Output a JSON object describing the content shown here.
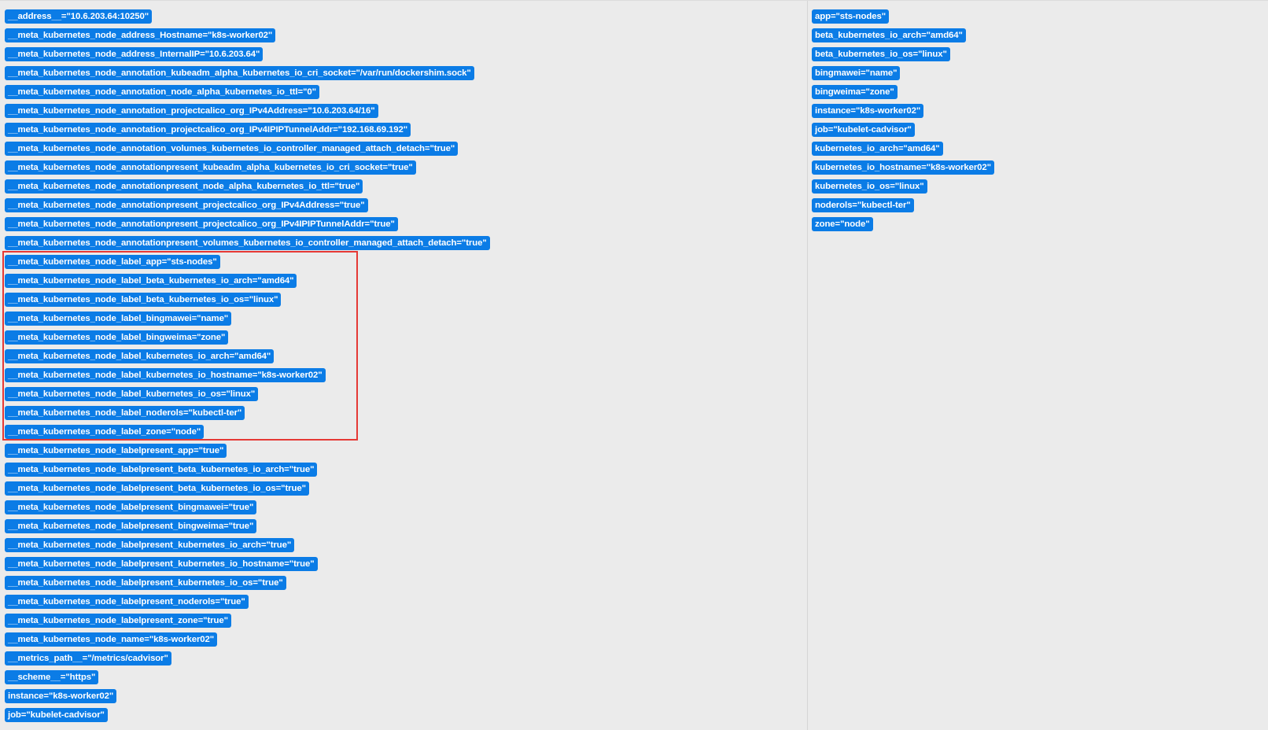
{
  "before_relabeling": [
    "__address__=\"10.6.203.64:10250\"",
    "__meta_kubernetes_node_address_Hostname=\"k8s-worker02\"",
    "__meta_kubernetes_node_address_InternalIP=\"10.6.203.64\"",
    "__meta_kubernetes_node_annotation_kubeadm_alpha_kubernetes_io_cri_socket=\"/var/run/dockershim.sock\"",
    "__meta_kubernetes_node_annotation_node_alpha_kubernetes_io_ttl=\"0\"",
    "__meta_kubernetes_node_annotation_projectcalico_org_IPv4Address=\"10.6.203.64/16\"",
    "__meta_kubernetes_node_annotation_projectcalico_org_IPv4IPIPTunnelAddr=\"192.168.69.192\"",
    "__meta_kubernetes_node_annotation_volumes_kubernetes_io_controller_managed_attach_detach=\"true\"",
    "__meta_kubernetes_node_annotationpresent_kubeadm_alpha_kubernetes_io_cri_socket=\"true\"",
    "__meta_kubernetes_node_annotationpresent_node_alpha_kubernetes_io_ttl=\"true\"",
    "__meta_kubernetes_node_annotationpresent_projectcalico_org_IPv4Address=\"true\"",
    "__meta_kubernetes_node_annotationpresent_projectcalico_org_IPv4IPIPTunnelAddr=\"true\"",
    "__meta_kubernetes_node_annotationpresent_volumes_kubernetes_io_controller_managed_attach_detach=\"true\"",
    "__meta_kubernetes_node_label_app=\"sts-nodes\"",
    "__meta_kubernetes_node_label_beta_kubernetes_io_arch=\"amd64\"",
    "__meta_kubernetes_node_label_beta_kubernetes_io_os=\"linux\"",
    "__meta_kubernetes_node_label_bingmawei=\"name\"",
    "__meta_kubernetes_node_label_bingweima=\"zone\"",
    "__meta_kubernetes_node_label_kubernetes_io_arch=\"amd64\"",
    "__meta_kubernetes_node_label_kubernetes_io_hostname=\"k8s-worker02\"",
    "__meta_kubernetes_node_label_kubernetes_io_os=\"linux\"",
    "__meta_kubernetes_node_label_noderols=\"kubectl-ter\"",
    "__meta_kubernetes_node_label_zone=\"node\"",
    "__meta_kubernetes_node_labelpresent_app=\"true\"",
    "__meta_kubernetes_node_labelpresent_beta_kubernetes_io_arch=\"true\"",
    "__meta_kubernetes_node_labelpresent_beta_kubernetes_io_os=\"true\"",
    "__meta_kubernetes_node_labelpresent_bingmawei=\"true\"",
    "__meta_kubernetes_node_labelpresent_bingweima=\"true\"",
    "__meta_kubernetes_node_labelpresent_kubernetes_io_arch=\"true\"",
    "__meta_kubernetes_node_labelpresent_kubernetes_io_hostname=\"true\"",
    "__meta_kubernetes_node_labelpresent_kubernetes_io_os=\"true\"",
    "__meta_kubernetes_node_labelpresent_noderols=\"true\"",
    "__meta_kubernetes_node_labelpresent_zone=\"true\"",
    "__meta_kubernetes_node_name=\"k8s-worker02\"",
    "__metrics_path__=\"/metrics/cadvisor\"",
    "__scheme__=\"https\"",
    "instance=\"k8s-worker02\"",
    "job=\"kubelet-cadvisor\""
  ],
  "after_relabeling": [
    "app=\"sts-nodes\"",
    "beta_kubernetes_io_arch=\"amd64\"",
    "beta_kubernetes_io_os=\"linux\"",
    "bingmawei=\"name\"",
    "bingweima=\"zone\"",
    "instance=\"k8s-worker02\"",
    "job=\"kubelet-cadvisor\"",
    "kubernetes_io_arch=\"amd64\"",
    "kubernetes_io_hostname=\"k8s-worker02\"",
    "kubernetes_io_os=\"linux\"",
    "noderols=\"kubectl-ter\"",
    "zone=\"node\""
  ],
  "colors": {
    "badge_background": "#0b7ce6",
    "badge_text": "#ffffff",
    "highlight_border": "#e53935",
    "page_background": "#ebebeb"
  }
}
